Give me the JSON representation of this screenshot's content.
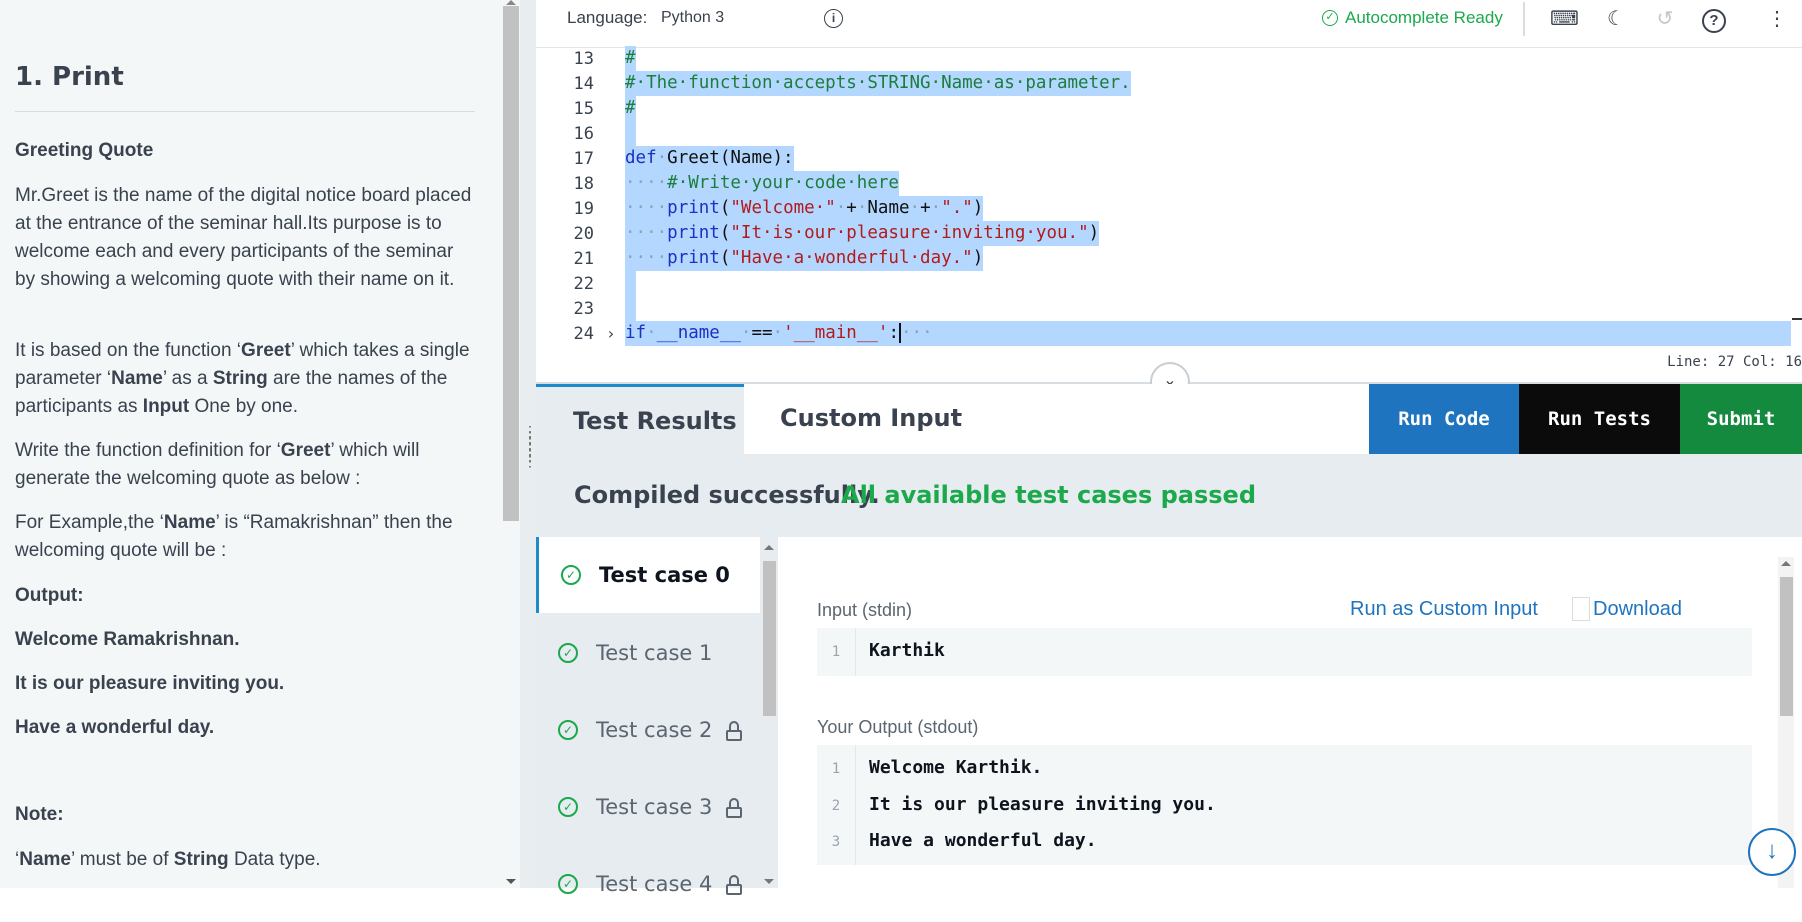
{
  "problem": {
    "title": "1. Print",
    "subtitle": "Greeting Quote",
    "p1": "Mr.Greet is the name of the digital notice board placed at the entrance of the seminar hall.Its purpose is to welcome each and every participants of the seminar by showing a welcoming quote with their name on it.",
    "p2_parts": [
      "It is based on the function ‘",
      "Greet",
      "’ which takes a single parameter ‘",
      "Name",
      "’ as a ",
      "String",
      " are the names of the participants as ",
      "Input",
      " One by one."
    ],
    "p3_parts": [
      "Write the function definition for ‘",
      "Greet",
      "’ which will generate the welcoming quote as below :"
    ],
    "p4_parts": [
      "For Example,the ‘",
      "Name",
      "’ is “Ramakrishnan” then the welcoming quote will be :"
    ],
    "output_label": "Output:",
    "out1": "Welcome Ramakrishnan.",
    "out2": "It is our pleasure inviting you.",
    "out3": "Have a wonderful day.",
    "note_label": "Note:",
    "note_parts": [
      "‘",
      "Name",
      "’ must be of ",
      "String",
      " Data type."
    ]
  },
  "topbar": {
    "language_label": "Language:",
    "language_value": "Python 3",
    "autocomplete": "Autocomplete Ready"
  },
  "editor": {
    "lines": [
      {
        "n": "13"
      },
      {
        "n": "14"
      },
      {
        "n": "15"
      },
      {
        "n": "16"
      },
      {
        "n": "17"
      },
      {
        "n": "18"
      },
      {
        "n": "19"
      },
      {
        "n": "20"
      },
      {
        "n": "21"
      },
      {
        "n": "22"
      },
      {
        "n": "23"
      },
      {
        "n": "24"
      }
    ],
    "status": "Line: 27 Col: 16"
  },
  "tabs": {
    "results": "Test Results",
    "custom": "Custom Input"
  },
  "buttons": {
    "run_code": "Run Code",
    "run_tests": "Run Tests",
    "submit": "Submit"
  },
  "banner": {
    "compiled": "Compiled successfully.",
    "passed": "All available test cases passed"
  },
  "testcases": [
    {
      "label": "Test case 0",
      "locked": false
    },
    {
      "label": "Test case 1",
      "locked": false
    },
    {
      "label": "Test case 2",
      "locked": true
    },
    {
      "label": "Test case 3",
      "locked": true
    },
    {
      "label": "Test case 4",
      "locked": true
    }
  ],
  "detail": {
    "input_label": "Input (stdin)",
    "run_custom": "Run as Custom Input",
    "download": "Download",
    "input_lines": [
      {
        "n": "1",
        "v": "Karthik"
      }
    ],
    "output_label": "Your Output (stdout)",
    "output_lines": [
      {
        "n": "1",
        "v": "Welcome Karthik."
      },
      {
        "n": "2",
        "v": "It is our pleasure inviting you."
      },
      {
        "n": "3",
        "v": "Have a wonderful day."
      }
    ]
  },
  "colors": {
    "accent": "#1f74bf",
    "success": "#1ba94c",
    "submit": "#138a3d",
    "selection": "#b3d7ff"
  }
}
